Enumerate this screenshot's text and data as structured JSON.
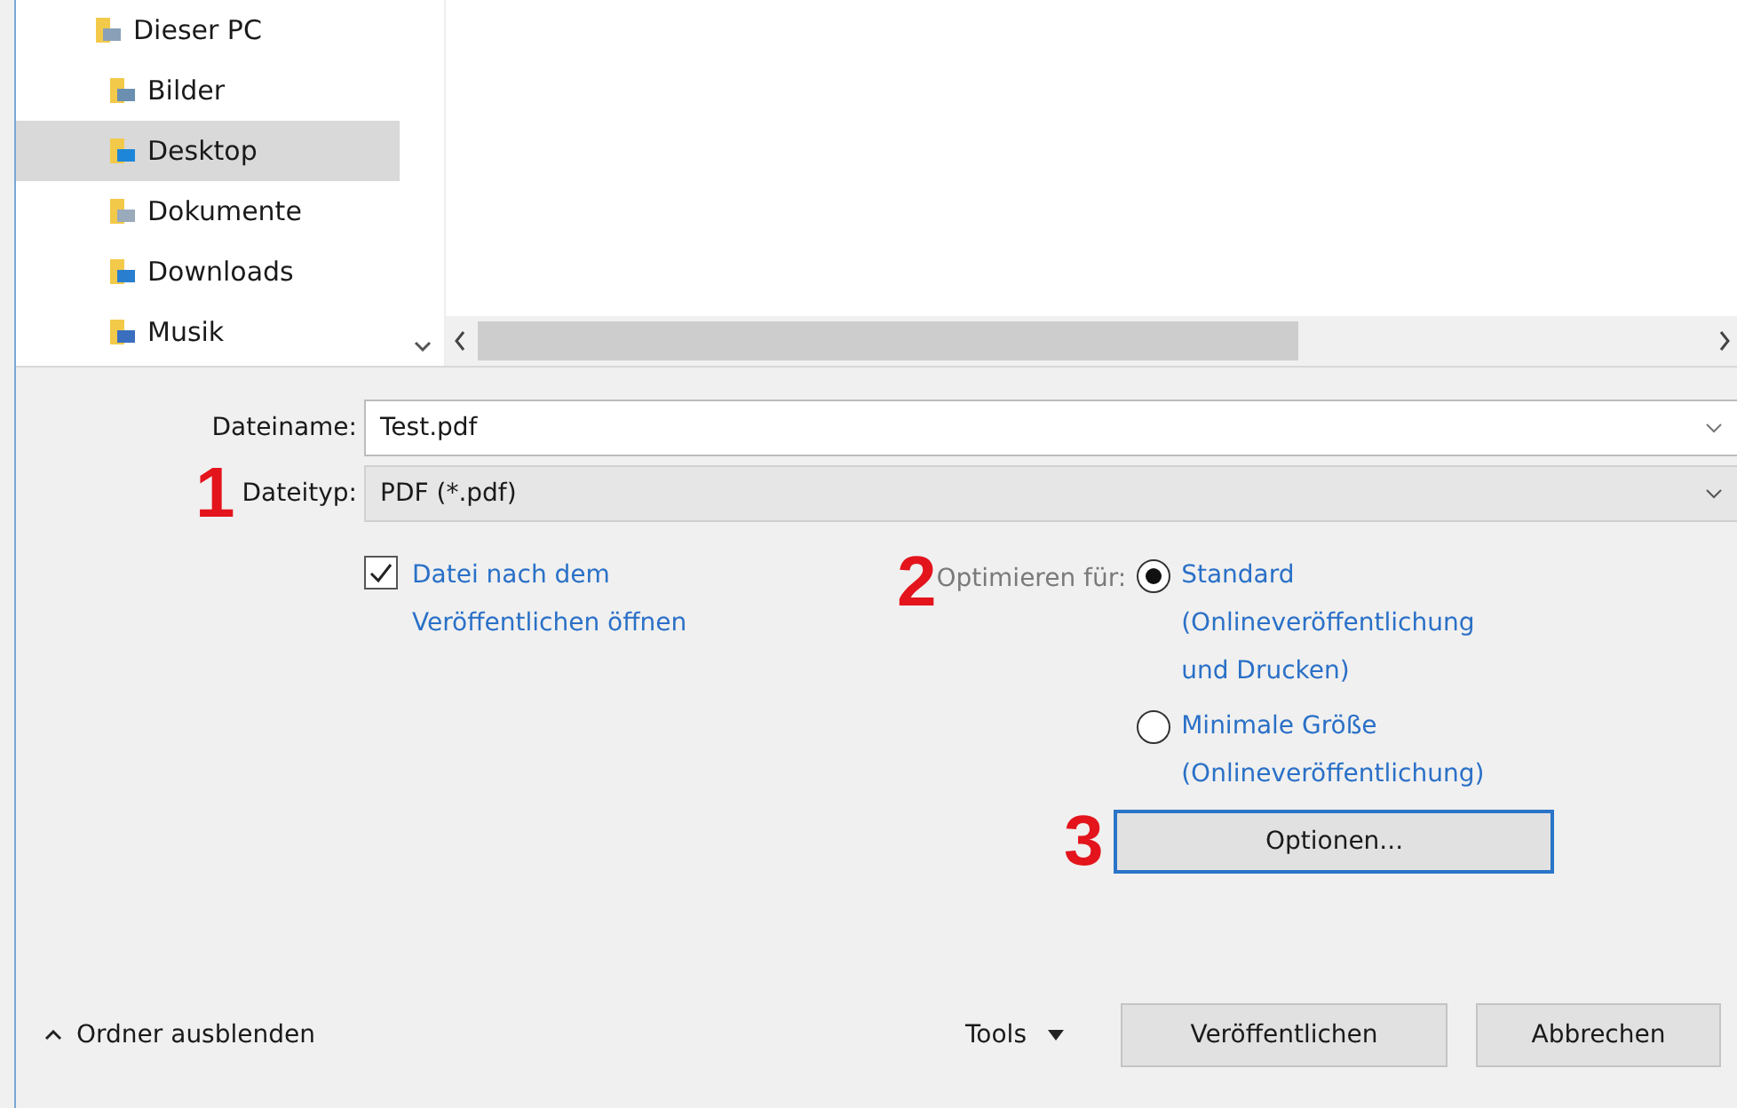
{
  "navigation": {
    "items": [
      {
        "label": "Dieser PC",
        "selected": false
      },
      {
        "label": "Bilder",
        "selected": false
      },
      {
        "label": "Desktop",
        "selected": true
      },
      {
        "label": "Dokumente",
        "selected": false
      },
      {
        "label": "Downloads",
        "selected": false
      },
      {
        "label": "Musik",
        "selected": false
      }
    ]
  },
  "form": {
    "file_name": {
      "label": "Dateiname:",
      "value": "Test.pdf"
    },
    "file_type": {
      "label": "Dateityp:",
      "value": "PDF (*.pdf)",
      "marker": "1"
    },
    "open_after": {
      "label": "Datei nach dem Veröffentlichen öffnen",
      "checked": true
    },
    "optimize": {
      "label": "Optimieren für:",
      "marker": "2",
      "options": [
        {
          "label": "Standard (Onlineveröffentlichung und Drucken)",
          "selected": true
        },
        {
          "label": "Minimale Größe (Onlineveröffentlichung)",
          "selected": false
        }
      ]
    },
    "options_button": {
      "label": "Optionen...",
      "marker": "3"
    }
  },
  "footer": {
    "toggle": "Ordner ausblenden",
    "tools": "Tools",
    "buttons": [
      "Veröffentlichen",
      "Abbrechen"
    ]
  }
}
